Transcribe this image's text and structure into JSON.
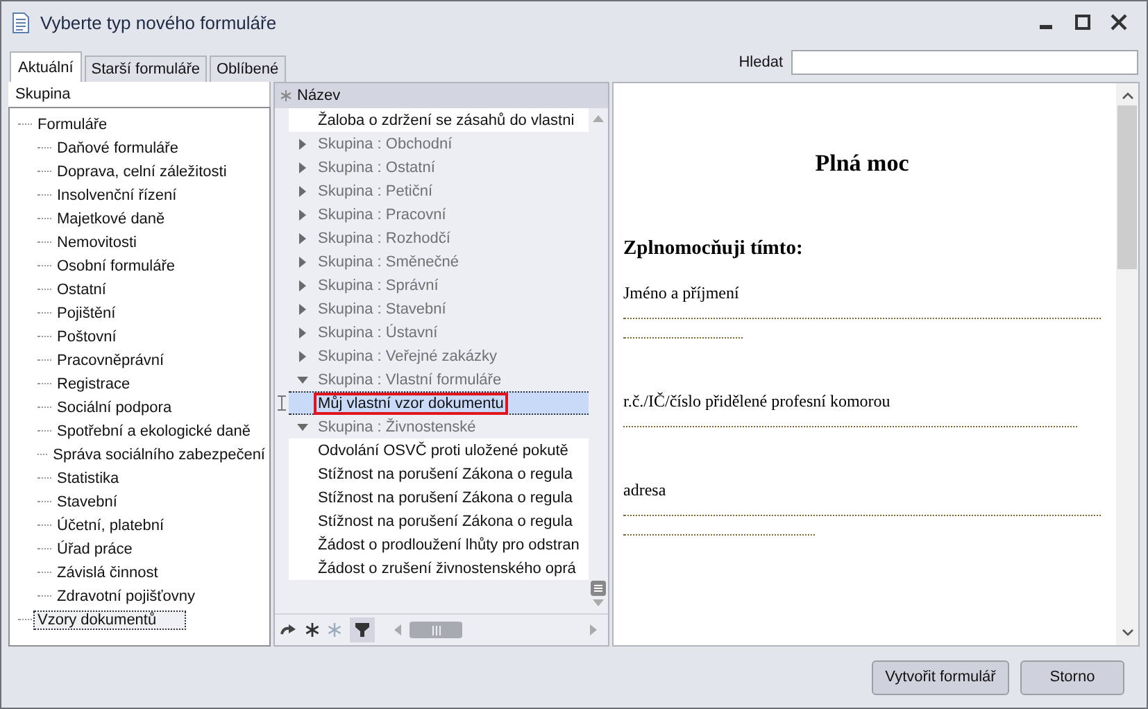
{
  "window": {
    "title": "Vyberte typ nového formuláře"
  },
  "tabs": [
    {
      "label": "Aktuální",
      "selected": true
    },
    {
      "label": "Starší formuláře",
      "selected": false
    },
    {
      "label": "Oblíbené",
      "selected": false
    }
  ],
  "search": {
    "label": "Hledat"
  },
  "groups_panel": {
    "heading": "Skupina",
    "tree": [
      {
        "label": "Formuláře",
        "selected": false,
        "children": [
          {
            "label": "Daňové formuláře",
            "selected": false
          },
          {
            "label": "Doprava, celní záležitosti",
            "selected": false
          },
          {
            "label": "Insolvenční řízení",
            "selected": false
          },
          {
            "label": "Majetkové daně",
            "selected": false
          },
          {
            "label": "Nemovitosti",
            "selected": false
          },
          {
            "label": "Osobní formuláře",
            "selected": false
          },
          {
            "label": "Ostatní",
            "selected": false
          },
          {
            "label": "Pojištění",
            "selected": false
          },
          {
            "label": "Poštovní",
            "selected": false
          },
          {
            "label": "Pracovněprávní",
            "selected": false
          },
          {
            "label": "Registrace",
            "selected": false
          },
          {
            "label": "Sociální podpora",
            "selected": false
          },
          {
            "label": "Spotřební a ekologické daně",
            "selected": false
          },
          {
            "label": "Správa sociálního zabezpečení",
            "selected": false
          },
          {
            "label": "Statistika",
            "selected": false
          },
          {
            "label": "Stavební",
            "selected": false
          },
          {
            "label": "Účetní, platební",
            "selected": false
          },
          {
            "label": "Úřad práce",
            "selected": false
          },
          {
            "label": "Závislá činnost",
            "selected": false
          },
          {
            "label": "Zdravotní pojišťovny",
            "selected": false
          }
        ]
      },
      {
        "label": "Vzory dokumentů",
        "selected": true
      }
    ]
  },
  "forms_list": {
    "column": "Název",
    "items": [
      {
        "kind": "document",
        "label": "Žaloba o zdržení se zásahů do vlastni",
        "selected": false
      },
      {
        "kind": "group",
        "label": "Skupina : Obchodní",
        "expanded": false
      },
      {
        "kind": "group",
        "label": "Skupina : Ostatní",
        "expanded": false
      },
      {
        "kind": "group",
        "label": "Skupina : Petiční",
        "expanded": false
      },
      {
        "kind": "group",
        "label": "Skupina : Pracovní",
        "expanded": false
      },
      {
        "kind": "group",
        "label": "Skupina : Rozhodčí",
        "expanded": false
      },
      {
        "kind": "group",
        "label": "Skupina : Směnečné",
        "expanded": false
      },
      {
        "kind": "group",
        "label": "Skupina : Správní",
        "expanded": false
      },
      {
        "kind": "group",
        "label": "Skupina : Stavební",
        "expanded": false
      },
      {
        "kind": "group",
        "label": "Skupina : Ústavní",
        "expanded": false
      },
      {
        "kind": "group",
        "label": "Skupina : Veřejné zakázky",
        "expanded": false
      },
      {
        "kind": "group",
        "label": "Skupina : Vlastní formuláře",
        "expanded": true,
        "children": [
          {
            "kind": "document",
            "label": "Můj vlastní vzor dokumentu",
            "selected": true
          }
        ]
      },
      {
        "kind": "group",
        "label": "Skupina : Živnostenské",
        "expanded": true,
        "children": [
          {
            "kind": "document",
            "label": "Odvolání OSVČ proti uložené pokutě",
            "selected": false
          },
          {
            "kind": "document",
            "label": "Stížnost na porušení Zákona o regula",
            "selected": false
          },
          {
            "kind": "document",
            "label": "Stížnost na porušení Zákona o regula",
            "selected": false
          },
          {
            "kind": "document",
            "label": "Stížnost na porušení Zákona o regula",
            "selected": false
          },
          {
            "kind": "document",
            "label": "Žádost o prodloužení lhůty pro odstran",
            "selected": false
          },
          {
            "kind": "document",
            "label": "Žádost o zrušení živnostenského oprá",
            "selected": false
          }
        ]
      }
    ]
  },
  "preview": {
    "title": "Plná moc",
    "heading": "Zplnomocňuji tímto:",
    "fields": [
      {
        "label": "Jméno a příjmení",
        "lines": [
          {
            "kind": "full"
          },
          {
            "kind": "short"
          }
        ]
      },
      {
        "label": "r.č./IČ/číslo přidělené profesní komorou",
        "lines": [
          {
            "kind": "long"
          }
        ]
      },
      {
        "label": "adresa",
        "lines": [
          {
            "kind": "full"
          },
          {
            "kind": "medium"
          }
        ]
      }
    ]
  },
  "buttons": [
    "Vytvořit formulář",
    "Storno"
  ]
}
